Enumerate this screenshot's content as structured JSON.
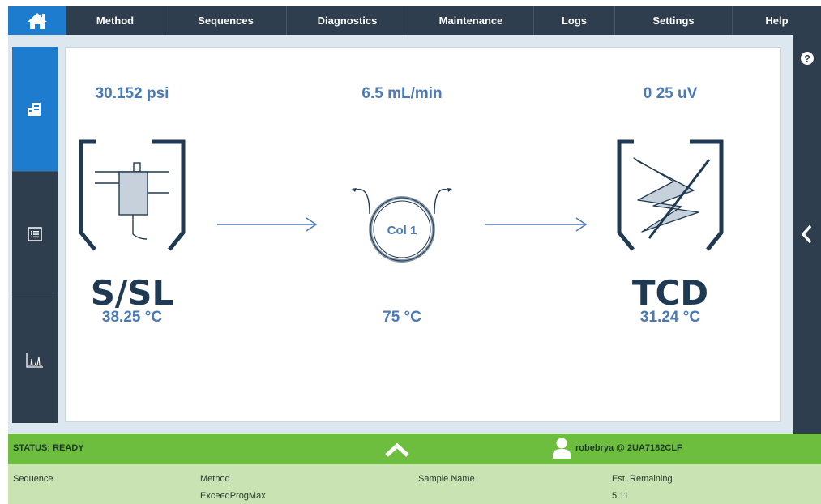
{
  "nav": {
    "home_icon": "home-icon",
    "items": [
      "Method",
      "Sequences",
      "Diagnostics",
      "Maintenance",
      "Logs",
      "Settings",
      "Help"
    ]
  },
  "left_rail": {
    "items": [
      {
        "icon": "instrument-icon",
        "active": true
      },
      {
        "icon": "list-icon",
        "active": false
      },
      {
        "icon": "chromatogram-icon",
        "active": false
      }
    ]
  },
  "right_rail": {
    "help_icon": "question-icon",
    "collapse_icon": "chevron-left-icon"
  },
  "flow": {
    "inlet": {
      "pressure": "30.152 psi",
      "name": "S/SL",
      "temperature": "38.25 °C"
    },
    "column": {
      "flow": "6.5 mL/min",
      "name": "Col 1",
      "temperature": "75 °C"
    },
    "detector": {
      "signal": "0 25 uV",
      "name": "TCD",
      "temperature": "31.24 °C"
    }
  },
  "status": {
    "text": "STATUS: READY",
    "user": "robebrya @ 2UA7182CLF"
  },
  "info": {
    "sequence_label": "Sequence",
    "sequence_value": "",
    "method_label": "Method",
    "method_value": "ExceedProgMax",
    "sample_label": "Sample Name",
    "sample_value": "",
    "remaining_label": "Est. Remaining",
    "remaining_value": "5.11"
  },
  "colors": {
    "accent_blue": "#1e7ccf",
    "nav_dark": "#2e3e4e",
    "status_green": "#6dbd3e",
    "info_green": "#c9e4b2",
    "reading_blue": "#4a7ab7"
  }
}
